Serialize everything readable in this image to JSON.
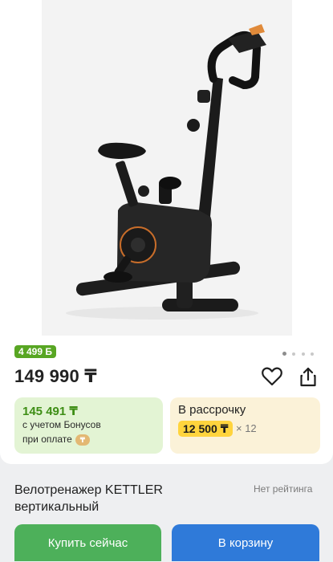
{
  "product": {
    "image_alt": "Велотренажер KETTLER вертикальный",
    "bonus_badge": "4 499 Б",
    "price": "149 990 ₸",
    "title": "Велотренажер KETTLER вертикальный",
    "rating": "Нет рейтинга"
  },
  "gallery": {
    "dots_total": 4,
    "active_index": 0
  },
  "bonus_offer": {
    "price": "145 491 ₸",
    "line1": "с учетом Бонусов",
    "line2": "при оплате",
    "coin_icon": "payment-coin-icon"
  },
  "installment": {
    "title": "В рассрочку",
    "amount": "12 500 ₸",
    "multiplier": "× 12"
  },
  "actions": {
    "buy_now": "Купить сейчас",
    "add_to_cart": "В корзину"
  },
  "colors": {
    "bonus_green": "#58a623",
    "green_card": "#e3f4d4",
    "yellow_card": "#fbf2d8",
    "yellow_amount": "#ffd43d",
    "buy_button": "#4db05a",
    "cart_button": "#2f7ad9"
  },
  "icons": [
    "heart-icon",
    "share-icon"
  ]
}
